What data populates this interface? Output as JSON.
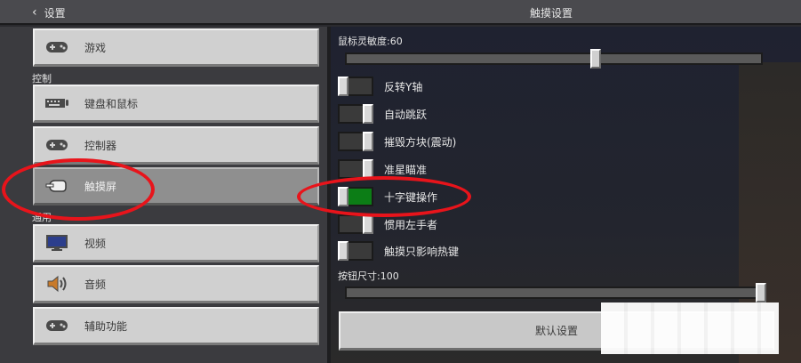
{
  "header": {
    "back_label": "设置",
    "title": "触摸设置"
  },
  "sidebar": {
    "sections": {
      "controls": "控制",
      "general": "通用"
    },
    "items": [
      {
        "label": "游戏",
        "icon": "gamepad-icon"
      },
      {
        "label": "键盘和鼠标",
        "icon": "keyboard-icon"
      },
      {
        "label": "控制器",
        "icon": "controller-icon"
      },
      {
        "label": "触摸屏",
        "icon": "touch-hand-icon",
        "selected": true
      },
      {
        "label": "视频",
        "icon": "monitor-icon"
      },
      {
        "label": "音频",
        "icon": "speaker-icon"
      },
      {
        "label": "辅助功能",
        "icon": "accessibility-gamepad-icon"
      }
    ]
  },
  "settings": {
    "mouse_sensitivity_label": "鼠标灵敏度:60",
    "mouse_sensitivity_value": 60,
    "toggles": [
      {
        "label": "反转Y轴",
        "on": false
      },
      {
        "label": "自动跳跃",
        "on": true
      },
      {
        "label": "摧毁方块(震动)",
        "on": true
      },
      {
        "label": "准星瞄准",
        "on": true
      },
      {
        "label": "十字键操作",
        "on": true
      },
      {
        "label": "惯用左手者",
        "on": true
      },
      {
        "label": "触摸只影响热键",
        "on": false
      }
    ],
    "button_size_label": "按钮尺寸:100",
    "button_size_value": 100,
    "default_button_label": "默认设置"
  },
  "colors": {
    "toggle_on": "#0c7d16",
    "annotation": "#e8141b"
  }
}
